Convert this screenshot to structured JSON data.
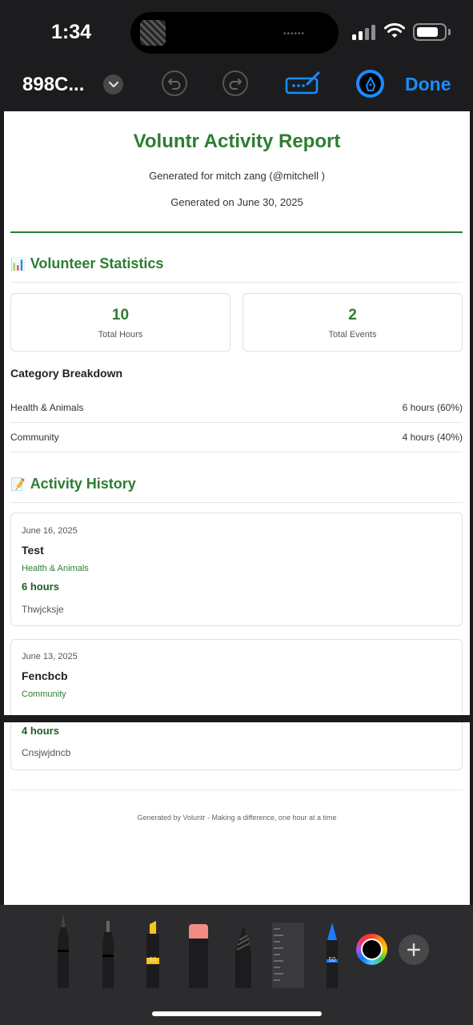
{
  "status_bar": {
    "time": "1:34"
  },
  "toolbar": {
    "doc_title": "898C...",
    "done_label": "Done"
  },
  "report": {
    "title": "Voluntr Activity Report",
    "generated_for": "Generated for mitch zang (@mitchell )",
    "generated_on": "Generated on June 30, 2025",
    "stats_heading": "Volunteer Statistics",
    "stats_icon": "📊",
    "stats": [
      {
        "value": "10",
        "label": "Total Hours"
      },
      {
        "value": "2",
        "label": "Total Events"
      }
    ],
    "category_heading": "Category Breakdown",
    "categories": [
      {
        "name": "Health & Animals",
        "value": "6 hours (60%)"
      },
      {
        "name": "Community",
        "value": "4 hours (40%)"
      }
    ],
    "history_heading": "Activity History",
    "history_icon": "📝",
    "activities": [
      {
        "date": "June 16, 2025",
        "title": "Test",
        "category": "Health & Animals",
        "hours": "6 hours",
        "description": "Thwjcksje"
      },
      {
        "date": "June 13, 2025",
        "title": "Fencbcb",
        "category": "Community",
        "hours": "4 hours",
        "description": "Cnsjwjdncb"
      }
    ],
    "footer": "Generated by Voluntr - Making a difference, one hour at a time"
  },
  "palette": {
    "tools": [
      {
        "name": "pen",
        "label": ""
      },
      {
        "name": "fineliner",
        "label": ""
      },
      {
        "name": "highlighter",
        "label": "80"
      },
      {
        "name": "eraser",
        "label": ""
      },
      {
        "name": "pencil",
        "label": ""
      },
      {
        "name": "ruler",
        "label": ""
      },
      {
        "name": "crayon",
        "label": "50"
      }
    ],
    "highlighter_color": "#f5c518",
    "eraser_color": "#f28b82",
    "crayon_color": "#1a7cff"
  },
  "colors": {
    "accent_blue": "#1a8cff",
    "report_green": "#2e7d32"
  }
}
